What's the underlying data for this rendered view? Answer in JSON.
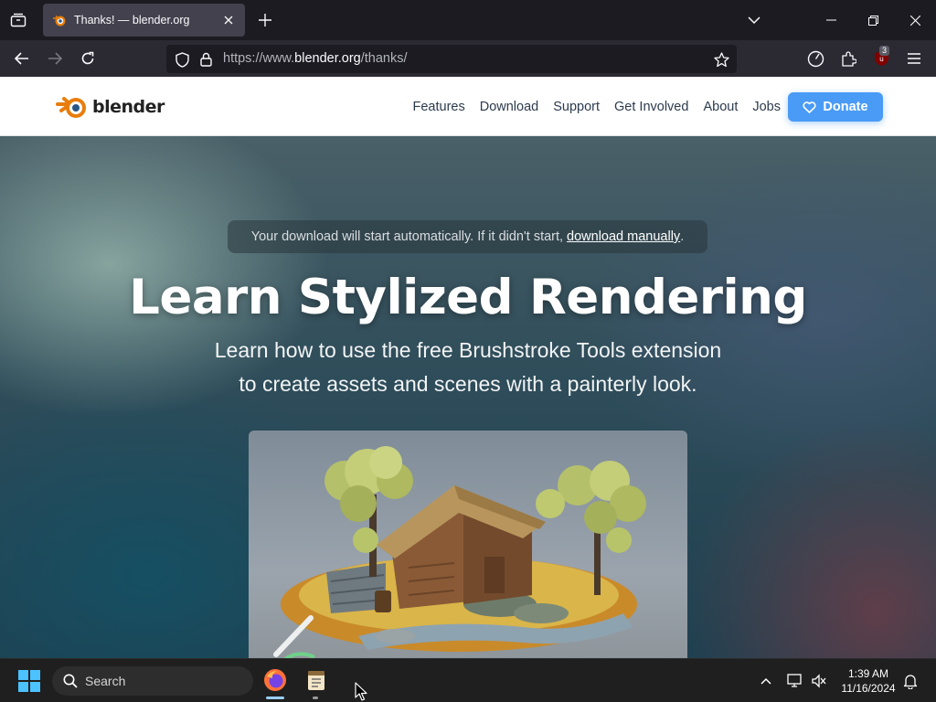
{
  "browser": {
    "tab": {
      "title": "Thanks! — blender.org"
    },
    "url": {
      "prefix": "https://www.",
      "domain": "blender.org",
      "path": "/thanks/"
    },
    "extension_badge": "3"
  },
  "site": {
    "logo_text": "blender",
    "nav": [
      {
        "label": "Features"
      },
      {
        "label": "Download"
      },
      {
        "label": "Support"
      },
      {
        "label": "Get Involved"
      },
      {
        "label": "About"
      },
      {
        "label": "Jobs"
      }
    ],
    "donate_label": "Donate",
    "accent_color": "#4a9bf5",
    "logo_orange": "#e87d0d",
    "logo_blue": "#265787"
  },
  "hero": {
    "notice_text": "Your download will start automatically. If it didn't start,",
    "notice_link": "download manually",
    "notice_end": ".",
    "title": "Learn Stylized Rendering",
    "subtitle_line1": "Learn how to use the free Brushstroke Tools extension",
    "subtitle_line2": "to create assets and scenes with a painterly look."
  },
  "taskbar": {
    "search_label": "Search",
    "time": "1:39 AM",
    "date": "11/16/2024"
  }
}
